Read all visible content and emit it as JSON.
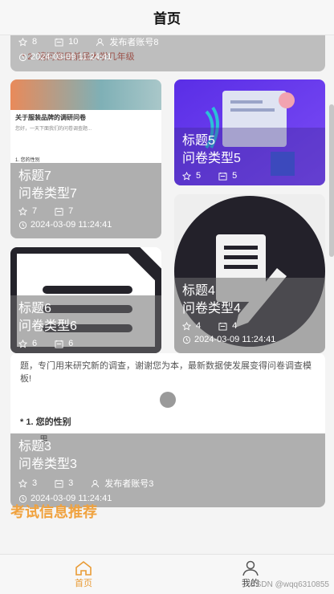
{
  "header": {
    "title": "首页"
  },
  "cards": [
    {
      "id": "c8",
      "title": "",
      "subtitle": "",
      "stars": "8",
      "forms": "10",
      "publisher": "发布者账号8",
      "time": "2024-03-09 11:24:41",
      "doc_text": "* 2. 请问您目前是大学几年级"
    },
    {
      "id": "c7",
      "title": "标题7",
      "subtitle": "问卷类型7",
      "stars": "7",
      "forms": "7",
      "time": "2024-03-09 11:24:41",
      "doc_title": "关于服装品牌的调研问卷",
      "doc_intro": "您好，一天下面我们的问卷调查题...",
      "doc_q": "1. 您的性别"
    },
    {
      "id": "c5",
      "title": "标题5",
      "subtitle": "问卷类型5",
      "stars": "5",
      "forms": "5"
    },
    {
      "id": "c4",
      "title": "标题4",
      "subtitle": "问卷类型4",
      "stars": "4",
      "forms": "4",
      "time": "2024-03-09 11:24:41"
    },
    {
      "id": "c6",
      "title": "标题6",
      "subtitle": "问卷类型6",
      "stars": "6",
      "forms": "6"
    },
    {
      "id": "c3",
      "title": "标题3",
      "subtitle": "问卷类型3",
      "stars": "3",
      "forms": "3",
      "publisher": "发布者账号3",
      "time": "2024-03-09 11:24:41",
      "doc_text": "题，专门用来研究新的调查，谢谢您为本，最新数据使发展变得问卷调查模板!",
      "doc_q": "* 1. 您的性别",
      "doc_opt": "男"
    }
  ],
  "section": {
    "recommend_title": "考试信息推荐"
  },
  "tabbar": {
    "home": "首页",
    "mine": "我的"
  },
  "watermark": "CSDN @wqq6310855",
  "colors": {
    "accent": "#e99b35",
    "purple": "#6a3ff0"
  }
}
